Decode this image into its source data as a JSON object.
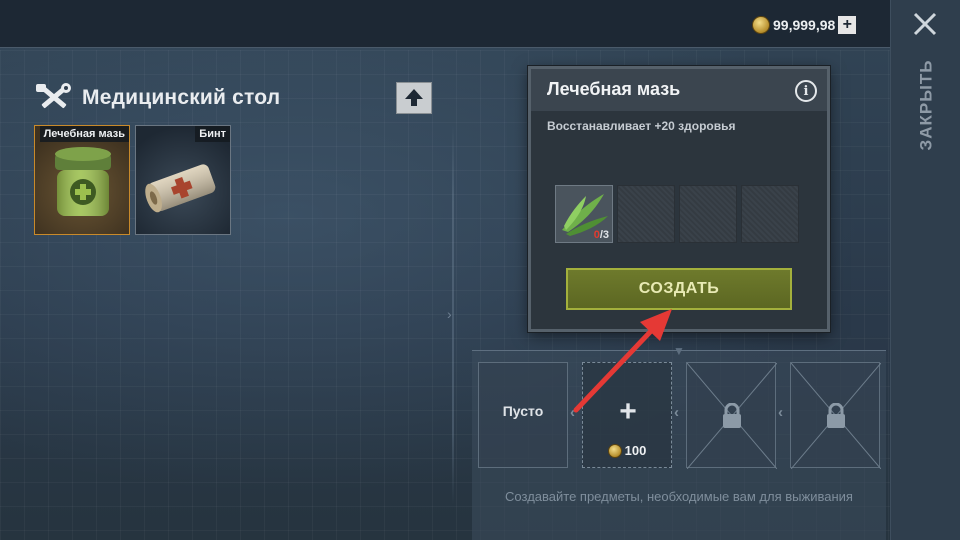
{
  "header": {
    "currency_amount": "99,999,98",
    "currency_icon": "coin-icon",
    "add_currency_label": "+"
  },
  "close": {
    "icon": "close-icon",
    "vertical_label": "ЗАКРЫТЬ"
  },
  "station": {
    "title": "Медицинский стол",
    "icon": "crossed-tools-icon",
    "upgrade_icon": "arrow-up-icon"
  },
  "recipes": [
    {
      "label": "Лечебная мазь",
      "icon": "ointment-jar-icon",
      "selected": true
    },
    {
      "label": "Бинт",
      "icon": "bandage-roll-icon",
      "selected": false
    }
  ],
  "popup": {
    "title": "Лечебная мазь",
    "info_icon": "info-icon",
    "info_label": "i",
    "description": "Восстанавливает +20 здоровья",
    "ingredients": [
      {
        "icon": "aloe-leaf-icon",
        "have": "0",
        "need": "/3"
      }
    ],
    "create_label": "СОЗДАТЬ"
  },
  "queue": {
    "slots": [
      {
        "type": "empty",
        "label": "Пусто"
      },
      {
        "type": "buy",
        "price": "100",
        "icon": "plus-icon"
      },
      {
        "type": "locked",
        "icon": "lock-icon"
      },
      {
        "type": "locked",
        "icon": "lock-icon"
      }
    ],
    "hint": "Создавайте предметы, необходимые вам для выживания"
  },
  "colors": {
    "accent_create": "#6e7a2c",
    "annotation_arrow": "#e53935",
    "selected_border": "#c98a2a"
  }
}
